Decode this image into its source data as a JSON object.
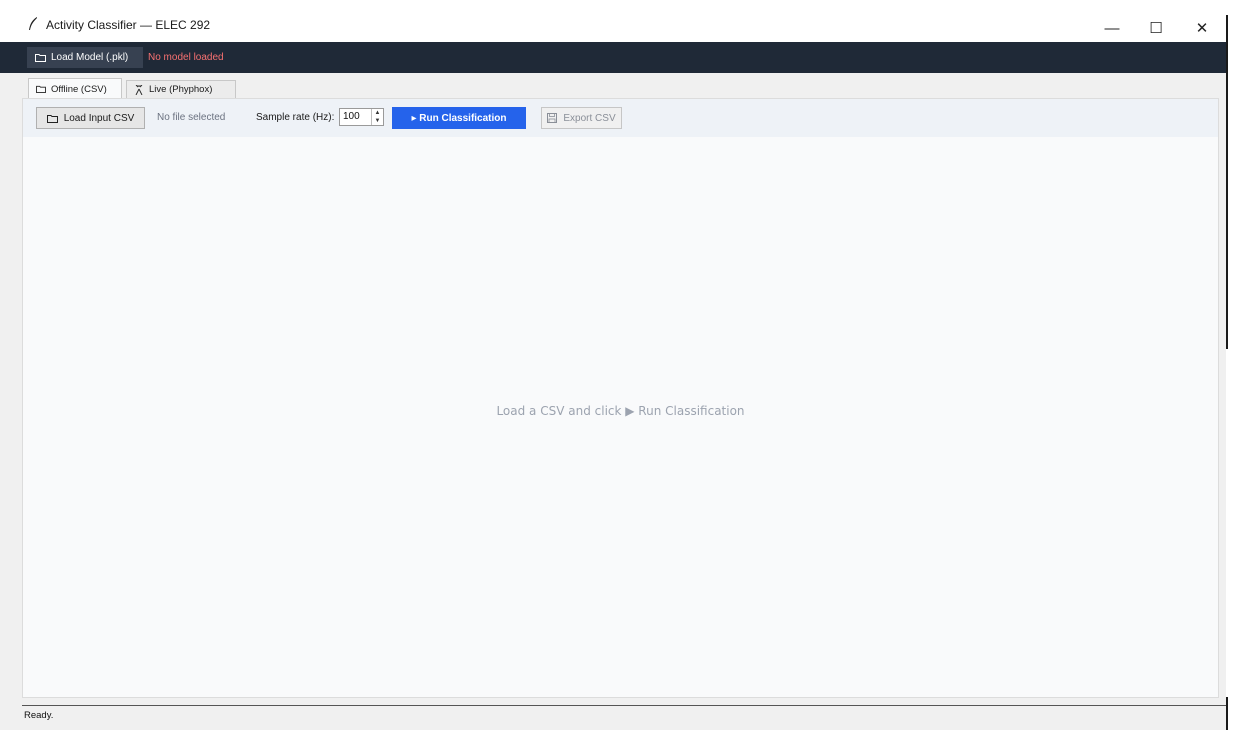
{
  "window": {
    "title": "Activity Classifier — ELEC 292",
    "controls": {
      "minimize": "—",
      "maximize": "☐",
      "close": "✕"
    }
  },
  "modelbar": {
    "load_model_label": "Load Model (.pkl)",
    "model_status": "No model loaded",
    "model_status_color": "#f87171"
  },
  "tabs": [
    {
      "label": "Offline (CSV)",
      "icon": "folder-icon",
      "active": true
    },
    {
      "label": "Live (Phyphox)",
      "icon": "antenna-icon",
      "active": false
    }
  ],
  "controls": {
    "load_csv_label": "Load Input CSV",
    "file_status": "No file selected",
    "sample_rate_label": "Sample rate (Hz):",
    "sample_rate_value": "100",
    "run_label": "▸ Run Classification",
    "export_label": "Export CSV"
  },
  "placeholder": "Load a CSV and click ▶ Run Classification",
  "statusbar": {
    "text": "Ready."
  },
  "colors": {
    "accent": "#2563eb",
    "toolbar_bg": "#1f2937"
  }
}
